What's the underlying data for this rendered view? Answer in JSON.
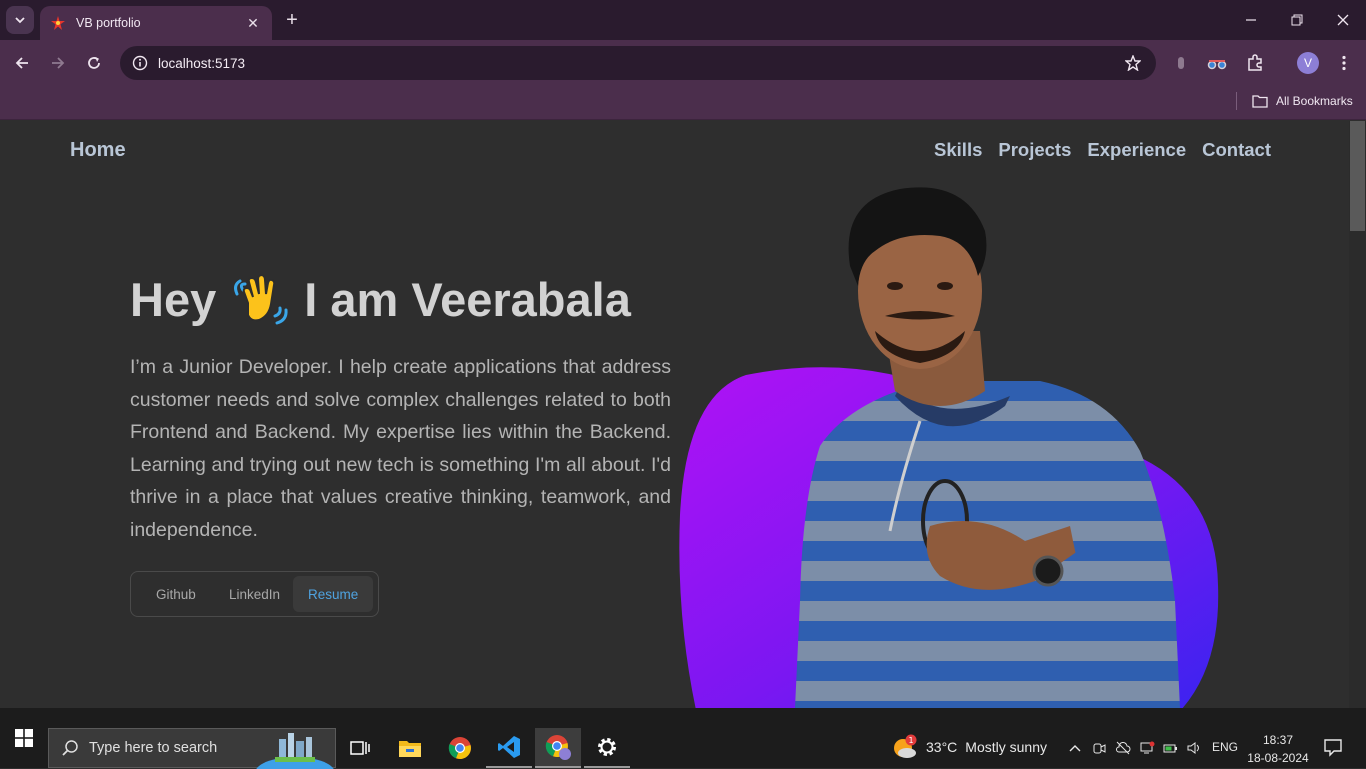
{
  "browser": {
    "tab_title": "VB portfolio",
    "url": "localhost:5173",
    "bookmarks_label": "All Bookmarks",
    "profile_initial": "V"
  },
  "site": {
    "nav_home": "Home",
    "nav_links": [
      "Skills",
      "Projects",
      "Experience",
      "Contact"
    ],
    "hero_prefix": "Hey",
    "hero_suffix": "I am Veerabala",
    "hero_emoji": "waving-hand",
    "description": "I’m a Junior Developer. I help create applications that address customer needs and solve complex challenges related to both Frontend and Backend. My expertise lies within the Backend. Learning and trying out new tech is something I'm all about. I'd thrive in a place that values creative thinking, teamwork, and independence.",
    "buttons": [
      "Github",
      "LinkedIn",
      "Resume"
    ],
    "active_button": "Resume",
    "accent_colors": {
      "blob_start": "#b012f5",
      "blob_end": "#3a24f0",
      "link_active": "#4fa3e0"
    }
  },
  "taskbar": {
    "search_placeholder": "Type here to search",
    "weather_temp": "33°C",
    "weather_text": "Mostly sunny",
    "weather_badge": "1",
    "language": "ENG",
    "time": "18:37",
    "date": "18-08-2024"
  }
}
